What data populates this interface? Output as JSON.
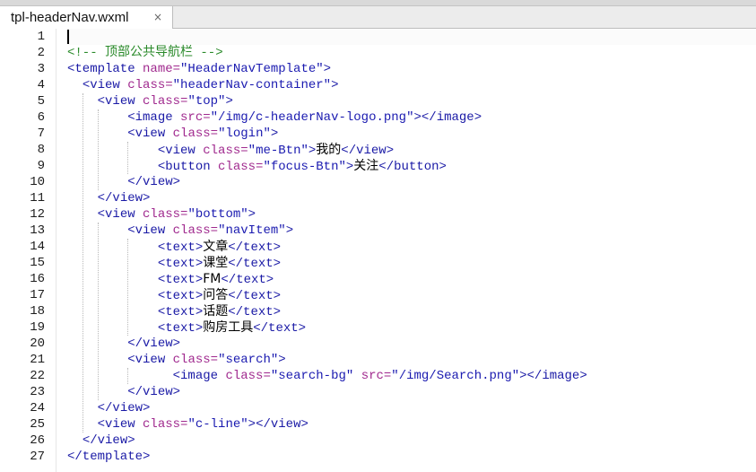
{
  "tab": {
    "label": "tpl-headerNav.wxml",
    "close_glyph": "×"
  },
  "colors": {
    "comment": "#2a8a2a",
    "tag": "#1a1aa6",
    "attribute": "#a0298e",
    "value": "#1a1ab0",
    "text": "#000000"
  },
  "editor": {
    "line_numbers": [
      "1",
      "2",
      "3",
      "4",
      "5",
      "6",
      "7",
      "8",
      "9",
      "10",
      "11",
      "12",
      "13",
      "14",
      "15",
      "16",
      "17",
      "18",
      "19",
      "20",
      "21",
      "22",
      "23",
      "24",
      "25",
      "26",
      "27"
    ],
    "lines": [
      [],
      [
        {
          "t": "comment",
          "v": "<!-- 顶部公共导航栏 -->"
        }
      ],
      [
        {
          "t": "tag",
          "v": "<template "
        },
        {
          "t": "attr",
          "v": "name="
        },
        {
          "t": "val",
          "v": "\"HeaderNavTemplate\""
        },
        {
          "t": "tag",
          "v": ">"
        }
      ],
      [
        {
          "t": "ws",
          "v": "  "
        },
        {
          "t": "tag",
          "v": "<view "
        },
        {
          "t": "attr",
          "v": "class="
        },
        {
          "t": "val",
          "v": "\"headerNav-container\""
        },
        {
          "t": "tag",
          "v": ">"
        }
      ],
      [
        {
          "t": "ws",
          "v": "    "
        },
        {
          "t": "tag",
          "v": "<view "
        },
        {
          "t": "attr",
          "v": "class="
        },
        {
          "t": "val",
          "v": "\"top\""
        },
        {
          "t": "tag",
          "v": ">"
        }
      ],
      [
        {
          "t": "ws",
          "v": "        "
        },
        {
          "t": "tag",
          "v": "<image "
        },
        {
          "t": "attr",
          "v": "src="
        },
        {
          "t": "val",
          "v": "\"/img/c-headerNav-logo.png\""
        },
        {
          "t": "tag",
          "v": "></image>"
        }
      ],
      [
        {
          "t": "ws",
          "v": "        "
        },
        {
          "t": "tag",
          "v": "<view "
        },
        {
          "t": "attr",
          "v": "class="
        },
        {
          "t": "val",
          "v": "\"login\""
        },
        {
          "t": "tag",
          "v": ">"
        }
      ],
      [
        {
          "t": "ws",
          "v": "            "
        },
        {
          "t": "tag",
          "v": "<view "
        },
        {
          "t": "attr",
          "v": "class="
        },
        {
          "t": "val",
          "v": "\"me-Btn\""
        },
        {
          "t": "tag",
          "v": ">"
        },
        {
          "t": "text",
          "v": "我的"
        },
        {
          "t": "tag",
          "v": "</view>"
        }
      ],
      [
        {
          "t": "ws",
          "v": "            "
        },
        {
          "t": "tag",
          "v": "<button "
        },
        {
          "t": "attr",
          "v": "class="
        },
        {
          "t": "val",
          "v": "\"focus-Btn\""
        },
        {
          "t": "tag",
          "v": ">"
        },
        {
          "t": "text",
          "v": "关注"
        },
        {
          "t": "tag",
          "v": "</button>"
        }
      ],
      [
        {
          "t": "ws",
          "v": "        "
        },
        {
          "t": "tag",
          "v": "</view>"
        }
      ],
      [
        {
          "t": "ws",
          "v": "    "
        },
        {
          "t": "tag",
          "v": "</view>"
        }
      ],
      [
        {
          "t": "ws",
          "v": "    "
        },
        {
          "t": "tag",
          "v": "<view "
        },
        {
          "t": "attr",
          "v": "class="
        },
        {
          "t": "val",
          "v": "\"bottom\""
        },
        {
          "t": "tag",
          "v": ">"
        }
      ],
      [
        {
          "t": "ws",
          "v": "        "
        },
        {
          "t": "tag",
          "v": "<view "
        },
        {
          "t": "attr",
          "v": "class="
        },
        {
          "t": "val",
          "v": "\"navItem\""
        },
        {
          "t": "tag",
          "v": ">"
        }
      ],
      [
        {
          "t": "ws",
          "v": "            "
        },
        {
          "t": "tag",
          "v": "<text>"
        },
        {
          "t": "text",
          "v": "文章"
        },
        {
          "t": "tag",
          "v": "</text>"
        }
      ],
      [
        {
          "t": "ws",
          "v": "            "
        },
        {
          "t": "tag",
          "v": "<text>"
        },
        {
          "t": "text",
          "v": "课堂"
        },
        {
          "t": "tag",
          "v": "</text>"
        }
      ],
      [
        {
          "t": "ws",
          "v": "            "
        },
        {
          "t": "tag",
          "v": "<text>"
        },
        {
          "t": "text",
          "v": "FM"
        },
        {
          "t": "tag",
          "v": "</text>"
        }
      ],
      [
        {
          "t": "ws",
          "v": "            "
        },
        {
          "t": "tag",
          "v": "<text>"
        },
        {
          "t": "text",
          "v": "问答"
        },
        {
          "t": "tag",
          "v": "</text>"
        }
      ],
      [
        {
          "t": "ws",
          "v": "            "
        },
        {
          "t": "tag",
          "v": "<text>"
        },
        {
          "t": "text",
          "v": "话题"
        },
        {
          "t": "tag",
          "v": "</text>"
        }
      ],
      [
        {
          "t": "ws",
          "v": "            "
        },
        {
          "t": "tag",
          "v": "<text>"
        },
        {
          "t": "text",
          "v": "购房工具"
        },
        {
          "t": "tag",
          "v": "</text>"
        }
      ],
      [
        {
          "t": "ws",
          "v": "        "
        },
        {
          "t": "tag",
          "v": "</view>"
        }
      ],
      [
        {
          "t": "ws",
          "v": "        "
        },
        {
          "t": "tag",
          "v": "<view "
        },
        {
          "t": "attr",
          "v": "class="
        },
        {
          "t": "val",
          "v": "\"search\""
        },
        {
          "t": "tag",
          "v": ">"
        }
      ],
      [
        {
          "t": "ws",
          "v": "              "
        },
        {
          "t": "tag",
          "v": "<image "
        },
        {
          "t": "attr",
          "v": "class="
        },
        {
          "t": "val",
          "v": "\"search-bg\""
        },
        {
          "t": "ws",
          "v": " "
        },
        {
          "t": "attr",
          "v": "src="
        },
        {
          "t": "val",
          "v": "\"/img/Search.png\""
        },
        {
          "t": "tag",
          "v": "></image>"
        }
      ],
      [
        {
          "t": "ws",
          "v": "        "
        },
        {
          "t": "tag",
          "v": "</view>"
        }
      ],
      [
        {
          "t": "ws",
          "v": "    "
        },
        {
          "t": "tag",
          "v": "</view>"
        }
      ],
      [
        {
          "t": "ws",
          "v": "    "
        },
        {
          "t": "tag",
          "v": "<view "
        },
        {
          "t": "attr",
          "v": "class="
        },
        {
          "t": "val",
          "v": "\"c-line\""
        },
        {
          "t": "tag",
          "v": "></view>"
        }
      ],
      [
        {
          "t": "ws",
          "v": "  "
        },
        {
          "t": "tag",
          "v": "</view>"
        }
      ],
      [
        {
          "t": "tag",
          "v": "</template>"
        }
      ]
    ]
  }
}
